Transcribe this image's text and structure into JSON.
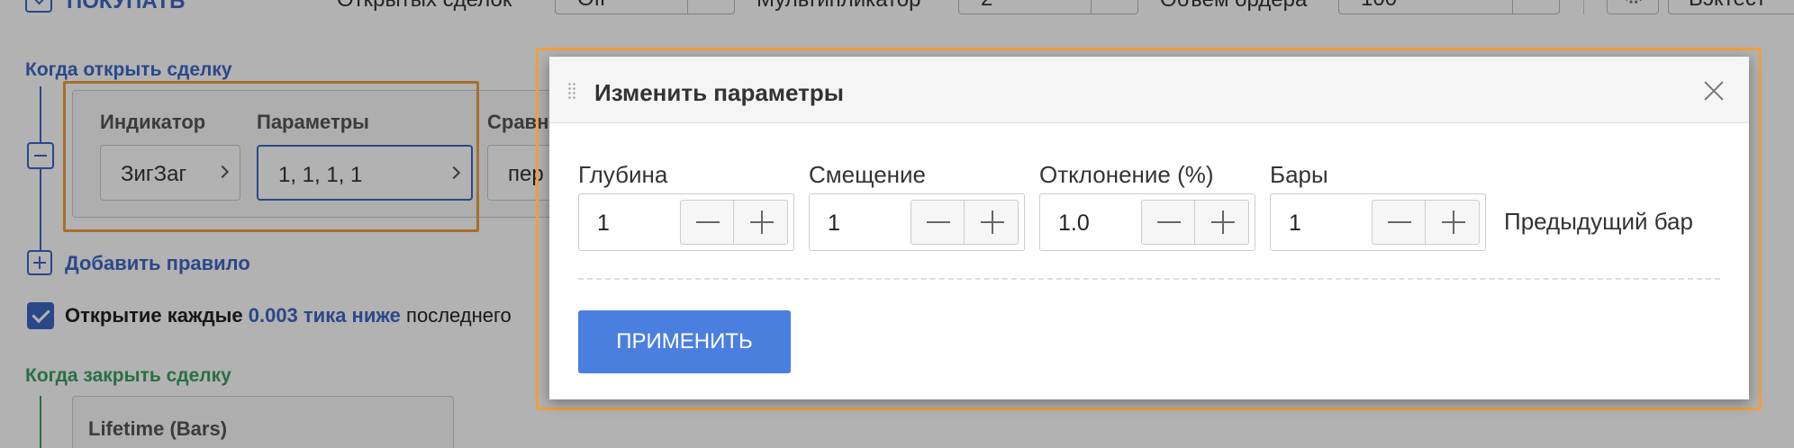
{
  "topbar": {
    "buy_label": "ПОКУПАТЬ",
    "open_trades_label": "Открытых сделок",
    "open_trades_value": "Off",
    "multiplier_label": "Мультипликатор",
    "multiplier_value": "2",
    "order_volume_label": "Объём ордера",
    "order_volume_value": "100",
    "backtest_label": "Бэктест"
  },
  "open_section": {
    "title": "Когда открыть сделку",
    "indicator_label": "Индикатор",
    "indicator_value": "ЗигЗаг",
    "params_label": "Параметры",
    "params_value": "1, 1, 1, 1",
    "compare_label": "Сравн",
    "compare_value": "пер",
    "add_rule": "Добавить правило",
    "checkbox_prefix": "Открытие каждые",
    "checkbox_link": "0.003 тика ниже",
    "checkbox_suffix": "последнего"
  },
  "close_section": {
    "title": "Когда закрыть сделку",
    "lifetime_label": "Lifetime (Bars)"
  },
  "modal": {
    "title": "Изменить параметры",
    "params": [
      {
        "label": "Глубина",
        "value": "1"
      },
      {
        "label": "Смещение",
        "value": "1"
      },
      {
        "label": "Отклонение (%)",
        "value": "1.0"
      },
      {
        "label": "Бары",
        "value": "1"
      }
    ],
    "prev_bar_label": "Предыдущий бар",
    "apply_label": "ПРИМЕНИТЬ"
  },
  "colors": {
    "accent": "#3d67c5",
    "apply_button": "#4a7fe0",
    "highlight": "#f0a040",
    "close_section": "#3aa061"
  }
}
